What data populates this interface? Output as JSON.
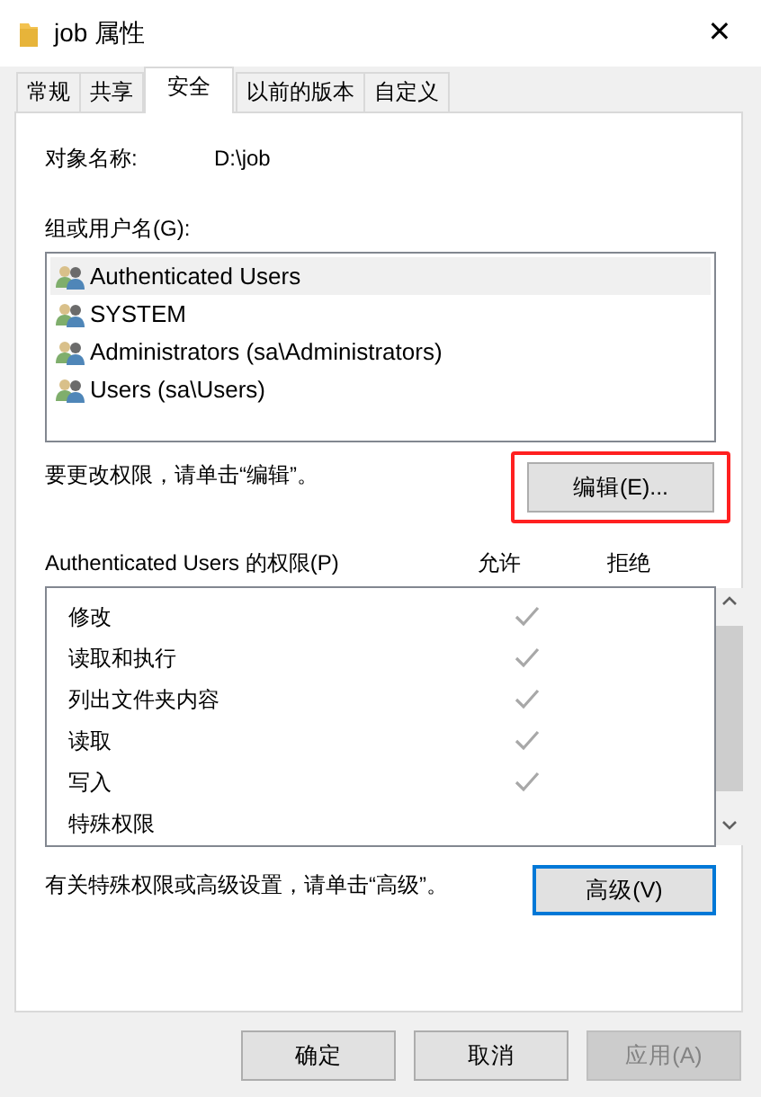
{
  "window": {
    "title": "job 属性",
    "close": "✕"
  },
  "tabs": [
    {
      "label": "常规",
      "selected": false
    },
    {
      "label": "共享",
      "selected": false
    },
    {
      "label": "安全",
      "selected": true
    },
    {
      "label": "以前的版本",
      "selected": false
    },
    {
      "label": "自定义",
      "selected": false
    }
  ],
  "object_name": {
    "label": "对象名称:",
    "value": "D:\\job"
  },
  "users_label": "组或用户名(G):",
  "users": [
    {
      "name": "Authenticated Users",
      "selected": true
    },
    {
      "name": "SYSTEM",
      "selected": false
    },
    {
      "name": "Administrators (sa\\Administrators)",
      "selected": false
    },
    {
      "name": "Users (sa\\Users)",
      "selected": false
    }
  ],
  "edit_hint": "要更改权限，请单击“编辑”。",
  "edit_button": {
    "label": "编辑(E)...",
    "highlighted": true
  },
  "permissions": {
    "title": "Authenticated Users 的权限(P)",
    "allow_header": "允许",
    "deny_header": "拒绝",
    "rows": [
      {
        "name": "修改",
        "allow": true,
        "deny": false
      },
      {
        "name": "读取和执行",
        "allow": true,
        "deny": false
      },
      {
        "name": "列出文件夹内容",
        "allow": true,
        "deny": false
      },
      {
        "name": "读取",
        "allow": true,
        "deny": false
      },
      {
        "name": "写入",
        "allow": true,
        "deny": false
      },
      {
        "name": "特殊权限",
        "allow": false,
        "deny": false
      }
    ]
  },
  "advanced_hint": "有关特殊权限或高级设置，请单击“高级”。",
  "advanced_button": {
    "label": "高级(V)",
    "focused": true
  },
  "buttons": [
    {
      "label": "确定",
      "disabled": false
    },
    {
      "label": "取消",
      "disabled": false
    },
    {
      "label": "应用(A)",
      "disabled": true
    }
  ]
}
